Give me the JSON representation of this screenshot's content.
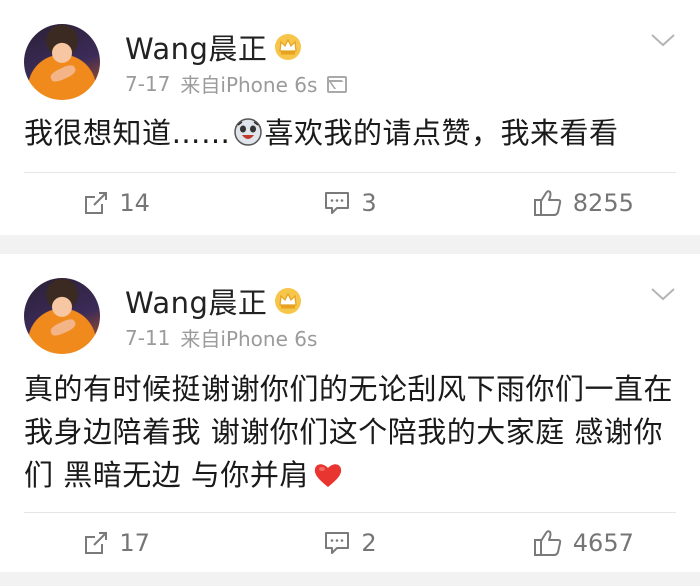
{
  "posts": [
    {
      "username": "Wang晨正",
      "time": "7-17",
      "source": "来自iPhone 6s",
      "text_before_emoji": "我很想知道……",
      "text_after_emoji": "喜欢我的请点赞，我来看看",
      "emoji": "laughing-crying-face-emoji",
      "repost_count": "14",
      "comment_count": "3",
      "like_count": "8255"
    },
    {
      "username": "Wang晨正",
      "time": "7-11",
      "source": "来自iPhone 6s",
      "text": "真的有时候挺谢谢你们的无论刮风下雨你们一直在我身边陪着我  谢谢你们这个陪我的大家庭 感谢你们 黑暗无边 与你并肩",
      "emoji": "red-heart-emoji",
      "repost_count": "17",
      "comment_count": "2",
      "like_count": "4657"
    }
  ],
  "colors": {
    "background": "#f2f2f2",
    "card": "#ffffff",
    "meta_text": "#9b9b9b",
    "action_text": "#757575",
    "crown_gold": "#f2b431",
    "heart_red": "#e8352f"
  }
}
